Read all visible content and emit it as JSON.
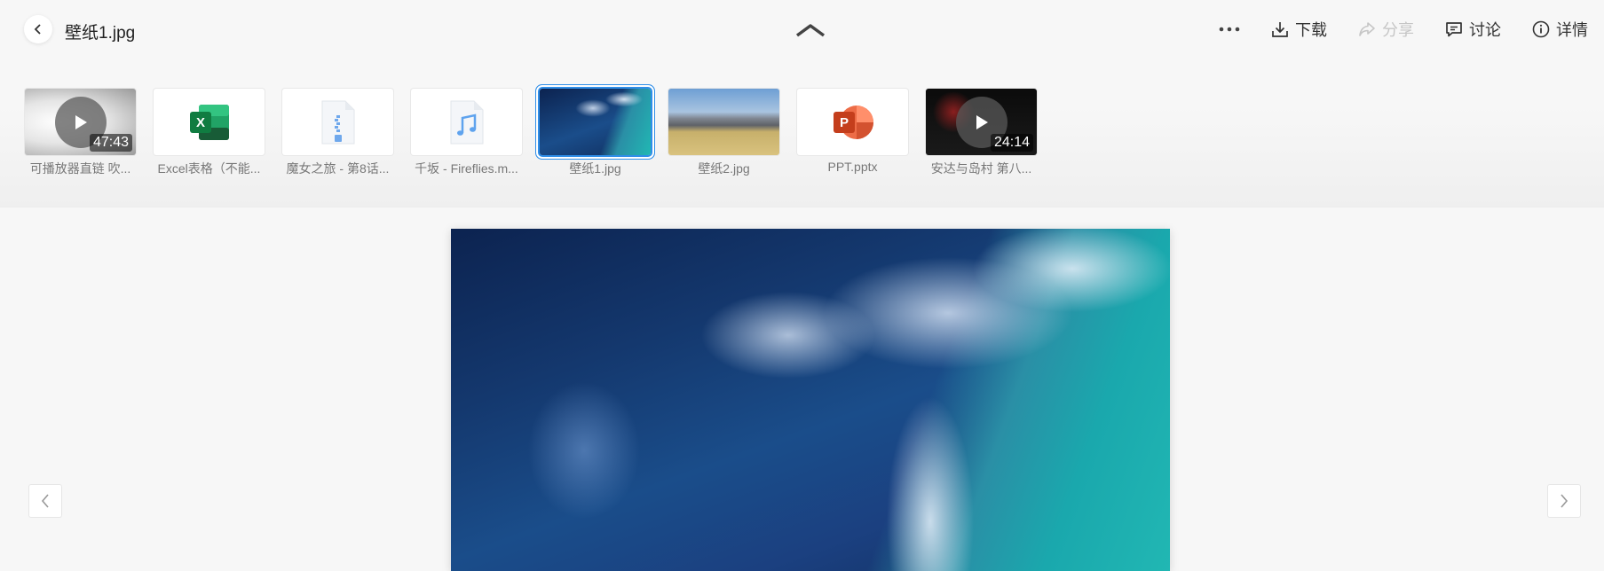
{
  "header": {
    "title": "壁纸1.jpg",
    "actions": [
      {
        "id": "download",
        "label": "下载",
        "icon": "download-icon",
        "disabled": false
      },
      {
        "id": "share",
        "label": "分享",
        "icon": "share-icon",
        "disabled": true
      },
      {
        "id": "discuss",
        "label": "讨论",
        "icon": "comment-icon",
        "disabled": false
      },
      {
        "id": "details",
        "label": "详情",
        "icon": "info-icon",
        "disabled": false
      }
    ]
  },
  "thumbnails": [
    {
      "label": "可播放器直链 吹...",
      "type": "video",
      "duration": "47:43"
    },
    {
      "label": "Excel表格（不能...",
      "type": "excel"
    },
    {
      "label": "魔女之旅 - 第8话...",
      "type": "archive"
    },
    {
      "label": "千坂 - Fireflies.m...",
      "type": "audio"
    },
    {
      "label": "壁纸1.jpg",
      "type": "image",
      "selected": true
    },
    {
      "label": "壁纸2.jpg",
      "type": "image"
    },
    {
      "label": "PPT.pptx",
      "type": "ppt"
    },
    {
      "label": "安达与岛村 第八...",
      "type": "video",
      "duration": "24:14"
    }
  ],
  "colors": {
    "accent": "#2f8ee8",
    "background": "#f7f7f7",
    "disabled_text": "#c6c6c6"
  }
}
